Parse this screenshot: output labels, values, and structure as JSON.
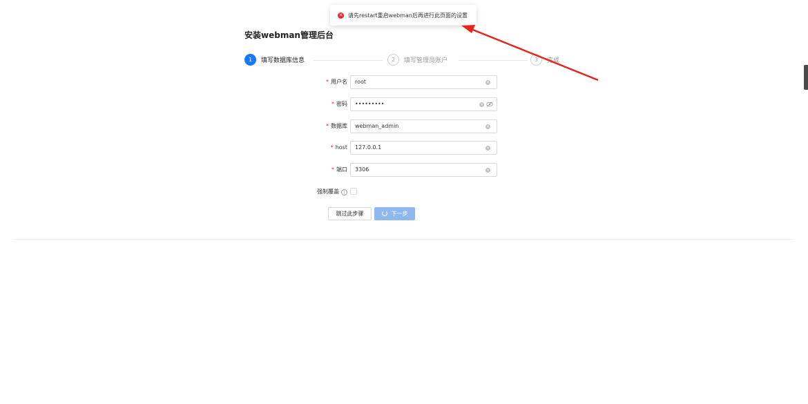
{
  "toast": {
    "icon": "error-icon",
    "message": "请先restart重启webman后再进行此页面的设置"
  },
  "page": {
    "title": "安装webman管理后台"
  },
  "steps": [
    {
      "number": "1",
      "label": "填写数据库信息",
      "state": "active"
    },
    {
      "number": "2",
      "label": "填写管理员账户",
      "state": "pending"
    },
    {
      "number": "3",
      "label": "完成",
      "state": "pending"
    }
  ],
  "form": {
    "username": {
      "label": "用户名",
      "value": "root"
    },
    "password": {
      "label": "密码",
      "value": "•••••••••"
    },
    "database": {
      "label": "数据库",
      "value": "webman_admin"
    },
    "host": {
      "label": "host",
      "value": "127.0.0.1"
    },
    "port": {
      "label": "端口",
      "value": "3306"
    },
    "force_overwrite": {
      "label": "强制覆盖",
      "checked": false
    }
  },
  "buttons": {
    "skip": "跳过此步骤",
    "next": "下一步"
  },
  "colors": {
    "primary": "#1677ff",
    "error": "#f5222d",
    "next_button_loading": "#8fb9ee",
    "annotation_arrow": "#e8231b"
  }
}
